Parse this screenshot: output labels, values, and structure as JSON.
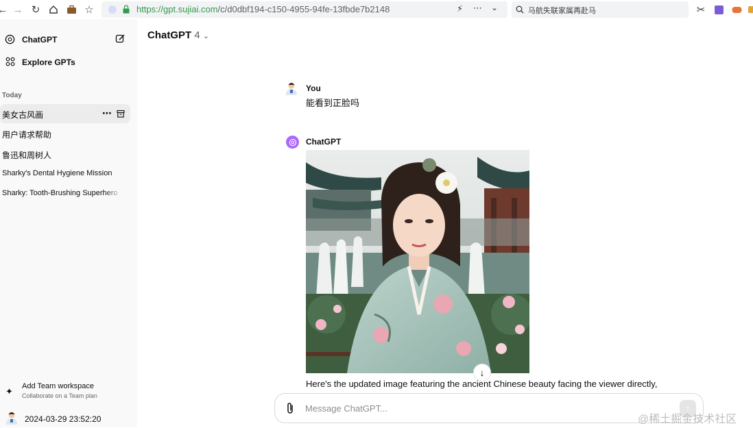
{
  "browser": {
    "url_scheme": "https://",
    "url_host": "gpt.sujiai.com",
    "url_path": "/c/d0dbf194-c150-4955-94fe-13fbde7b2148",
    "search_text": "马航失联家属再赴马"
  },
  "sidebar": {
    "app_name": "ChatGPT",
    "explore_label": "Explore GPTs",
    "section_today": "Today",
    "history": [
      {
        "label": "美女古风画"
      },
      {
        "label": "用户请求帮助"
      },
      {
        "label": "鲁迅和周树人"
      },
      {
        "label": "Sharky's Dental Hygiene Mission"
      },
      {
        "label": "Sharky: Tooth-Brushing Superhero"
      }
    ],
    "team_title": "Add Team workspace",
    "team_subtitle": "Collaborate on a Team plan",
    "user_label": "2024-03-29 23:52:20"
  },
  "header": {
    "model_name": "ChatGPT",
    "model_version": "4"
  },
  "conversation": {
    "user_author": "You",
    "user_message": "能看到正脸吗",
    "assistant_author": "ChatGPT",
    "assistant_text": "Here's the updated image featuring the ancient Chinese beauty facing the viewer directly,"
  },
  "composer": {
    "placeholder": "Message ChatGPT..."
  },
  "watermark": "@稀土掘金技术社区",
  "colors": {
    "accent_purple": "#ab68ff",
    "sidebar_bg": "#f9f9f9",
    "url_green": "#2e9b4b"
  }
}
